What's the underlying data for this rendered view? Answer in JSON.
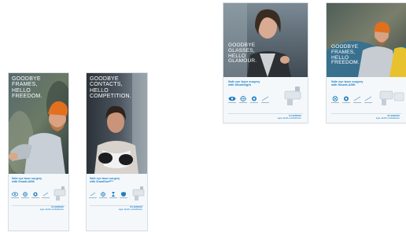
{
  "posters": [
    {
      "headline": "GOODBYE\nFRAMES,\nHELLO\nFREEDOM.",
      "tagline": "Safe eye laser surgery\nwith SmartLASIK",
      "brand": "SCHWIND\neye-tech-solutions"
    },
    {
      "headline": "GOODBYE\nCONTACTS,\nHELLO\nCOMPETITION.",
      "tagline": "Safe eye laser surgery\nwith SmartSurfᴬᶜᵉ",
      "brand": "SCHWIND\neye-tech-solutions"
    },
    {
      "headline": "GOODBYE\nGLASSES,\nHELLO\nGLAMOUR.",
      "tagline": "Safe eye laser surgery\nwith SmartSight",
      "brand": "SCHWIND\neye-tech-solutions"
    },
    {
      "headline": "GOODBYE\nFRAMES,\nHELLO\nFREEDOM.",
      "tagline": "Safe eye laser surgery\nwith SmartLASIK",
      "brand": "SCHWIND\neye-tech-solutions"
    }
  ],
  "icons": [
    "eye-icon",
    "crosshair-icon",
    "target-icon",
    "laser-icon"
  ],
  "colors": {
    "accent": "#1e7fc1",
    "info_bg": "#f4f8fb"
  }
}
